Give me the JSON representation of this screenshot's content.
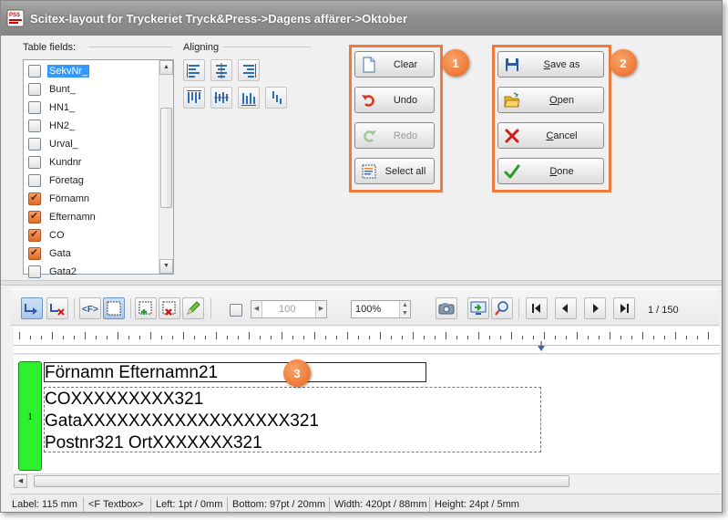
{
  "window": {
    "title": "Scitex-layout for Tryckeriet Tryck&Press->Dagens affärer->Oktober"
  },
  "table_fields": {
    "label": "Table fields:",
    "items": [
      {
        "label": "SekvNr_",
        "checked": false,
        "selected": true
      },
      {
        "label": "Bunt_",
        "checked": false,
        "selected": false
      },
      {
        "label": "HN1_",
        "checked": false,
        "selected": false
      },
      {
        "label": "HN2_",
        "checked": false,
        "selected": false
      },
      {
        "label": "Urval_",
        "checked": false,
        "selected": false
      },
      {
        "label": "Kundnr",
        "checked": false,
        "selected": false
      },
      {
        "label": "Företag",
        "checked": false,
        "selected": false
      },
      {
        "label": "Förnamn",
        "checked": true,
        "selected": false
      },
      {
        "label": "Efternamn",
        "checked": true,
        "selected": false
      },
      {
        "label": "CO",
        "checked": true,
        "selected": false
      },
      {
        "label": "Gata",
        "checked": true,
        "selected": false
      },
      {
        "label": "Gata2",
        "checked": false,
        "selected": false
      }
    ]
  },
  "aligning": {
    "label": "Aligning"
  },
  "actions_group1": {
    "badge": "1",
    "clear": "Clear",
    "undo": "Undo",
    "redo": "Redo",
    "select_all": "Select all"
  },
  "actions_group2": {
    "badge": "2",
    "save_as": "Save as",
    "open": "Open",
    "cancel": "Cancel",
    "done": "Done"
  },
  "toolbar": {
    "checkbox_checked": false,
    "spin_value": "100",
    "zoom": "100%",
    "page_info": "1 / 150"
  },
  "canvas": {
    "badge": "3",
    "row_number": "1",
    "line1": "Förnamn Efternamn21",
    "line2": "COXXXXXXXXX321",
    "line3": "GataXXXXXXXXXXXXXXXXXX321",
    "line4": "Postnr321 OrtXXXXXXX321"
  },
  "statusbar": {
    "label": "Label: 115 mm",
    "type": "<F Textbox>",
    "left": "Left: 1pt / 0mm",
    "bottom": "Bottom: 97pt / 20mm",
    "width": "Width: 420pt / 88mm",
    "height": "Height: 24pt / 5mm"
  },
  "colors": {
    "accent_orange": "#f07a3c",
    "row_marker_green": "#2ef02e",
    "selection_blue": "#3399ff"
  }
}
